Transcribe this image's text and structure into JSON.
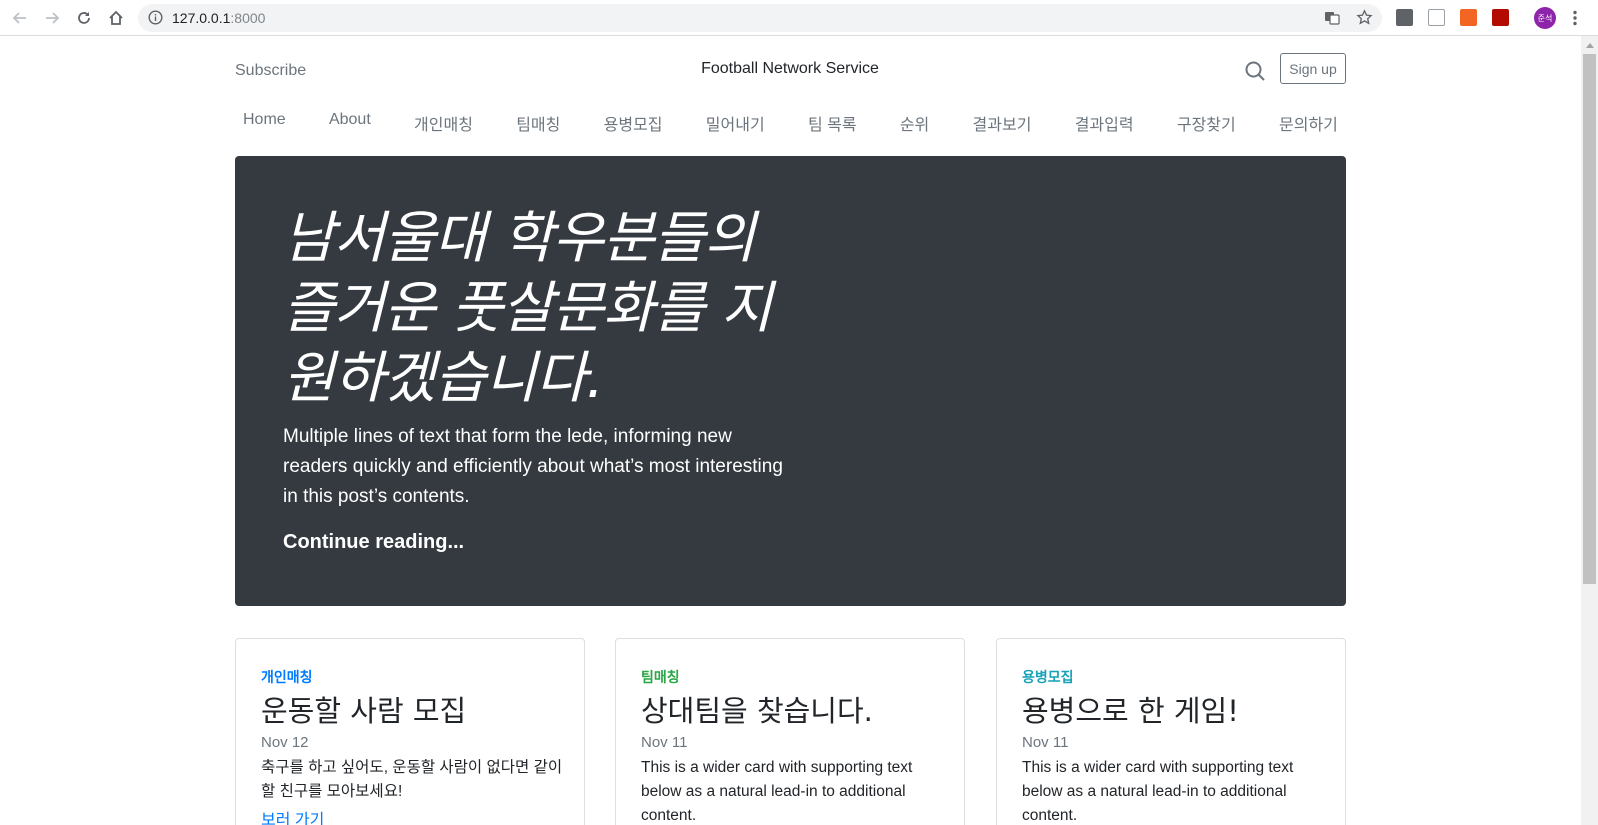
{
  "browser": {
    "url_host": "127.0.0.1",
    "url_port": ":8000",
    "profile_initials": "준석"
  },
  "header": {
    "subscribe": "Subscribe",
    "brand": "Football Network Service",
    "signup": "Sign up"
  },
  "nav": [
    "Home",
    "About",
    "개인매칭",
    "팀매칭",
    "용병모집",
    "밀어내기",
    "팀 목록",
    "순위",
    "결과보기",
    "결과입력",
    "구장찾기",
    "문의하기"
  ],
  "hero": {
    "title": "남서울대 학우분들의 즐거운 풋살문화를 지원하겠습니다.",
    "lead": "Multiple lines of text that form the lede, informing new readers quickly and efficiently about what’s most interesting in this post’s contents.",
    "cta": "Continue reading..."
  },
  "cards": [
    {
      "category": "개인매칭",
      "category_color": "#007bff",
      "title": "운동할 사람 모집",
      "date": "Nov 12",
      "text": "축구를 하고 싶어도, 운동할 사람이 없다면 같이 할 친구를 모아보세요!",
      "link": "보러 가기"
    },
    {
      "category": "팀매칭",
      "category_color": "#28a745",
      "title": "상대팀을 찾습니다.",
      "date": "Nov 11",
      "text": "This is a wider card with supporting text below as a natural lead-in to additional content.",
      "link": ""
    },
    {
      "category": "용병모집",
      "category_color": "#17a2b8",
      "title": "용병으로 한 게임!",
      "date": "Nov 11",
      "text": "This is a wider card with supporting text below as a natural lead-in to additional content.",
      "link": ""
    }
  ],
  "colors": {
    "hero_bg": "#343a40",
    "muted": "#6c757d",
    "link": "#007bff"
  }
}
